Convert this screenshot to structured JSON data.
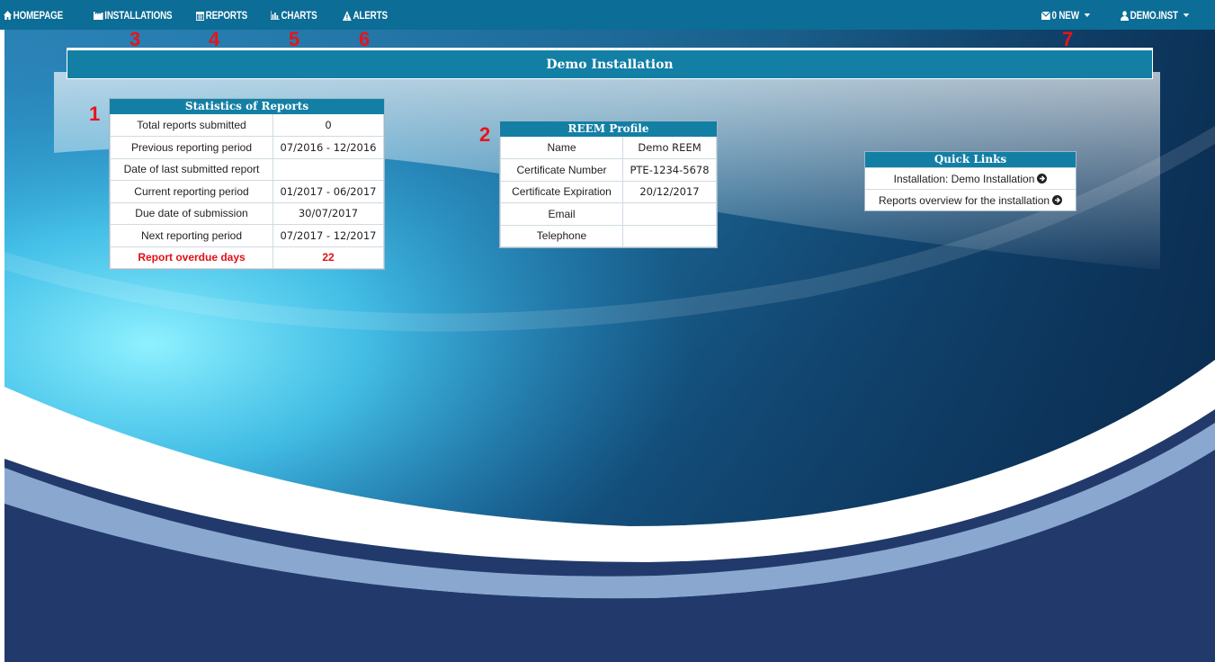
{
  "nav": {
    "home": "HOMEPAGE",
    "installations": "INSTALLATIONS",
    "reports": "REPORTS",
    "charts": "CHARTS",
    "alerts": "ALERTS",
    "messages": "0 NEW",
    "user": "DEMO.INST"
  },
  "annotations": [
    "1",
    "2",
    "3",
    "4",
    "5",
    "6",
    "7"
  ],
  "page": {
    "title": "Demo Installation"
  },
  "stats": {
    "heading": "Statistics of Reports",
    "rows": [
      {
        "label": "Total reports submitted",
        "value": "0"
      },
      {
        "label": "Previous reporting period",
        "value": "07/2016 - 12/2016"
      },
      {
        "label": "Date of last submitted report",
        "value": ""
      },
      {
        "label": "Current reporting period",
        "value": "01/2017 - 06/2017"
      },
      {
        "label": "Due date of submission",
        "value": "30/07/2017"
      },
      {
        "label": "Next reporting period",
        "value": "07/2017 - 12/2017"
      },
      {
        "label": "Report overdue days",
        "value": "22"
      }
    ]
  },
  "profile": {
    "heading": "REEM Profile",
    "rows": [
      {
        "label": "Name",
        "value": "Demo REEM"
      },
      {
        "label": "Certificate Number",
        "value": "PTE-1234-5678"
      },
      {
        "label": "Certificate Expiration",
        "value": "20/12/2017"
      },
      {
        "label": "Email",
        "value": ""
      },
      {
        "label": "Telephone",
        "value": ""
      }
    ]
  },
  "quick_links": {
    "heading": "Quick Links",
    "items": [
      {
        "label": "Installation: Demo Installation"
      },
      {
        "label": "Reports overview for the installation"
      }
    ]
  },
  "colors": {
    "nav": "#0c6d96",
    "header": "#137fa5",
    "alert_red": "#e10f16"
  },
  "icons": {
    "home": "home-icon",
    "installations": "factory-icon",
    "reports": "calendar-icon",
    "charts": "bar-chart-icon",
    "alerts": "warning-icon",
    "messages": "envelope-icon",
    "user": "user-icon",
    "link": "circle-arrow-right-icon"
  }
}
